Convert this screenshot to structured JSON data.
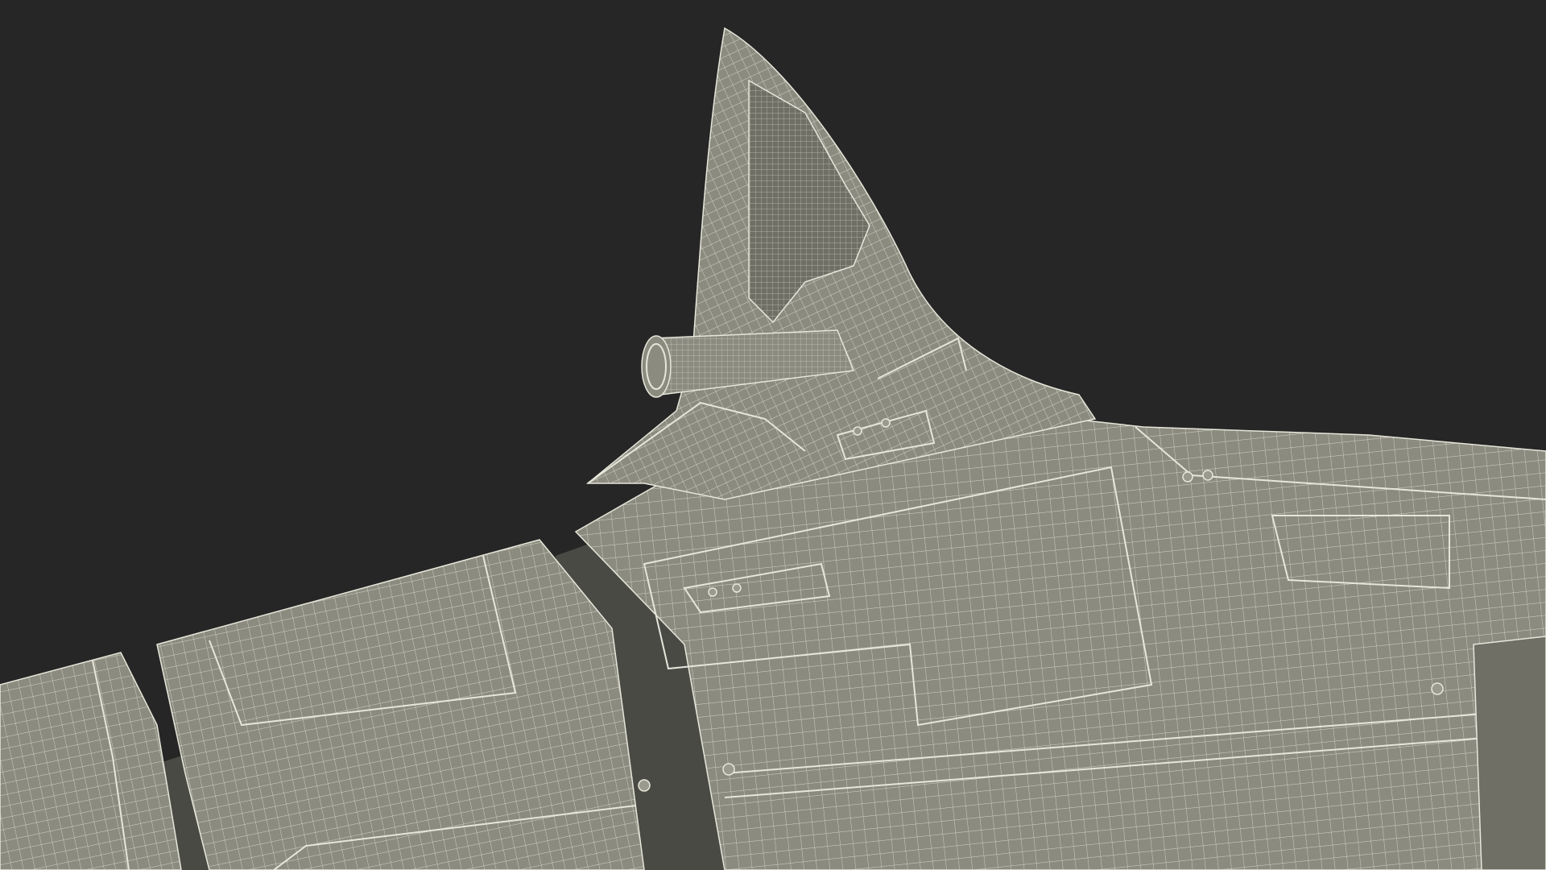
{
  "scene": {
    "background_color": "#262626",
    "surface_color": "#8b8b80",
    "surface_shade_color": "#6f6f66",
    "surface_light_color": "#9a9a8f",
    "wire_color": "#e6e6da",
    "recess_color": "#4a4a45"
  }
}
